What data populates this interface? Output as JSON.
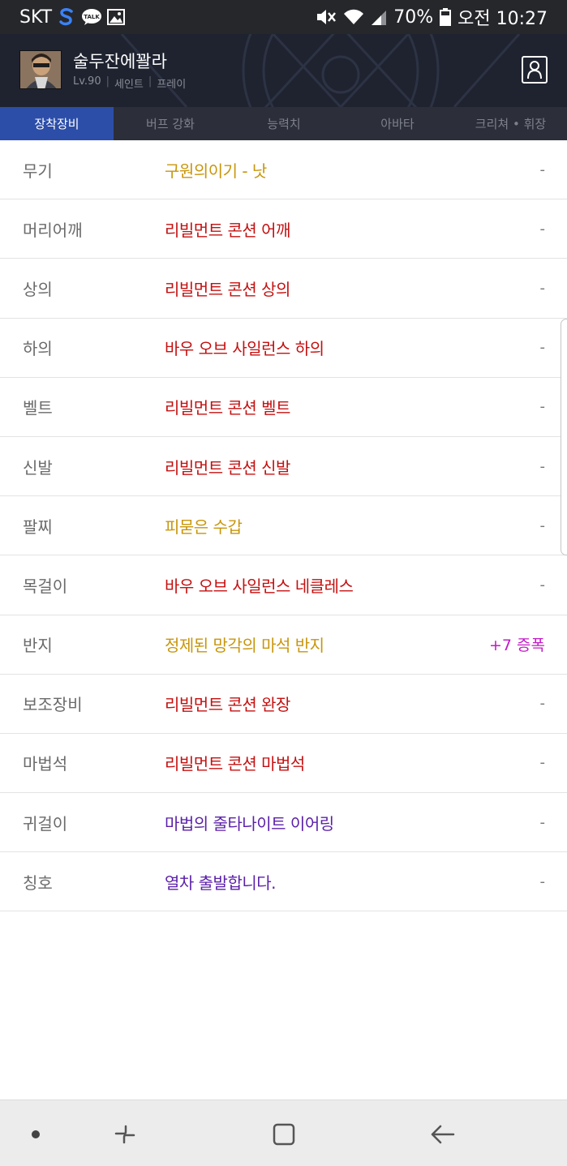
{
  "status_bar": {
    "carrier": "SKT",
    "talk_badge": "TALK",
    "battery": "70%",
    "time": "오전 10:27",
    "icons": [
      "samsung-s-icon",
      "kakaotalk-icon",
      "gallery-icon",
      "mute-icon",
      "wifi-icon",
      "signal-icon",
      "battery-icon"
    ]
  },
  "character": {
    "name": "술두잔에꽐라",
    "level": "Lv.90",
    "class": "세인트",
    "server": "프레이"
  },
  "tabs": [
    {
      "label": "장착장비",
      "active": true
    },
    {
      "label": "버프 강화",
      "active": false
    },
    {
      "label": "능력치",
      "active": false
    },
    {
      "label": "아바타",
      "active": false
    },
    {
      "label": "크리쳐 • 휘장",
      "active": false
    }
  ],
  "equipment": [
    {
      "slot": "무기",
      "item": "구원의이기 - 낫",
      "color": "#c8960c",
      "option": "-"
    },
    {
      "slot": "머리어깨",
      "item": "리빌먼트 콘션 어깨",
      "color": "#c41010",
      "option": "-"
    },
    {
      "slot": "상의",
      "item": "리빌먼트 콘션 상의",
      "color": "#c41010",
      "option": "-"
    },
    {
      "slot": "하의",
      "item": "바우 오브 사일런스 하의",
      "color": "#c41010",
      "option": "-"
    },
    {
      "slot": "벨트",
      "item": "리빌먼트 콘션 벨트",
      "color": "#c41010",
      "option": "-"
    },
    {
      "slot": "신발",
      "item": "리빌먼트 콘션 신발",
      "color": "#c41010",
      "option": "-"
    },
    {
      "slot": "팔찌",
      "item": "피묻은 수갑",
      "color": "#c8960c",
      "option": "-"
    },
    {
      "slot": "목걸이",
      "item": "바우 오브 사일런스 네클레스",
      "color": "#c41010",
      "option": "-"
    },
    {
      "slot": "반지",
      "item": "정제된 망각의 마석 반지",
      "color": "#c8960c",
      "option": "+7 증폭"
    },
    {
      "slot": "보조장비",
      "item": "리빌먼트 콘션 완장",
      "color": "#c41010",
      "option": "-"
    },
    {
      "slot": "마법석",
      "item": "리빌먼트 콘션 마법석",
      "color": "#c41010",
      "option": "-"
    },
    {
      "slot": "귀걸이",
      "item": "마법의 줄타나이트 이어링",
      "color": "#5a1fa8",
      "option": "-"
    },
    {
      "slot": "칭호",
      "item": "열차 출발합니다.",
      "color": "#5a1fa8",
      "option": "-"
    }
  ],
  "nav_bar": {
    "buttons": [
      "dot-icon",
      "recent-apps-icon",
      "home-icon",
      "back-icon"
    ]
  }
}
